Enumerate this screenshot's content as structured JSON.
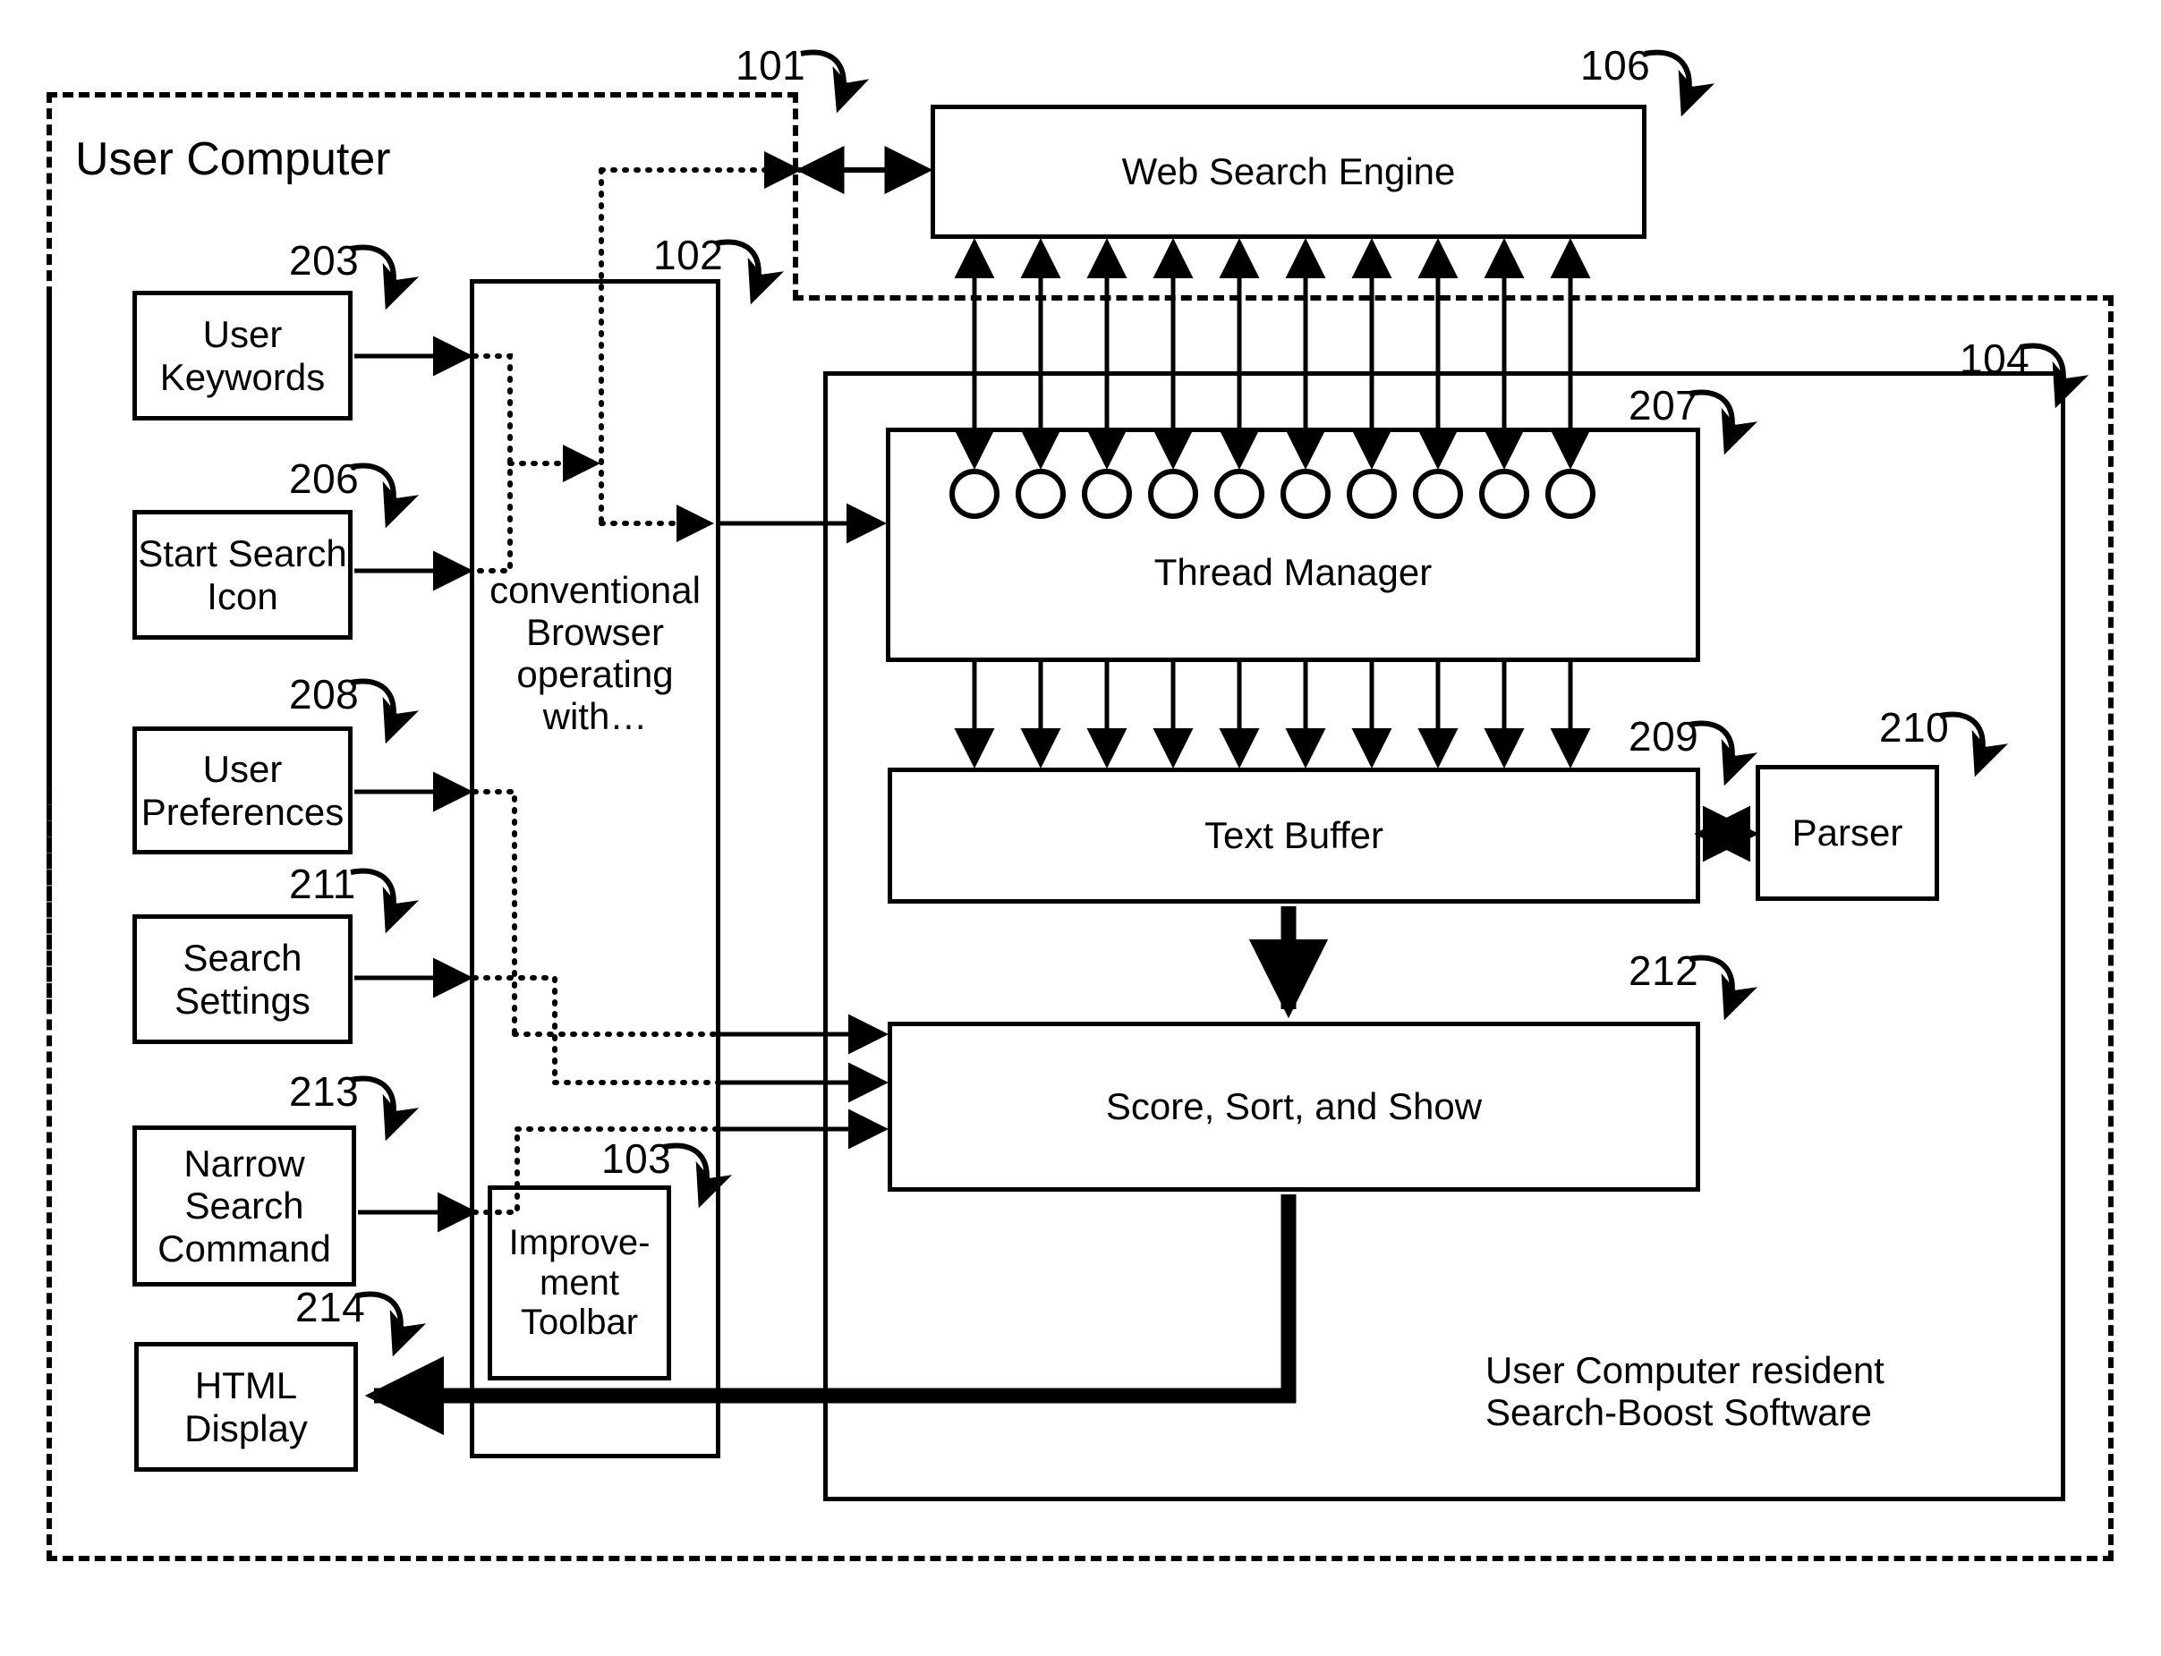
{
  "figure": {
    "outer_label": "User Computer",
    "inner_note_line1": "User Computer resident",
    "inner_note_line2": "Search-Boost Software"
  },
  "reference_numerals": {
    "user_computer_boundary": "101",
    "browser": "102",
    "improvement_toolbar": "103",
    "search_boost_software": "104",
    "web_search_engine": "106",
    "user_keywords": "203",
    "start_search_icon": "206",
    "thread_manager": "207",
    "user_preferences": "208",
    "text_buffer": "209",
    "parser": "210",
    "search_settings": "211",
    "score_sort_show": "212",
    "narrow_search_command": "213",
    "html_display": "214"
  },
  "blocks": {
    "web_search_engine": {
      "label": "Web Search Engine",
      "ref": "106"
    },
    "user_keywords": {
      "label": "User\nKeywords",
      "line1": "User",
      "line2": "Keywords",
      "ref": "203"
    },
    "start_search_icon": {
      "line1": "Start Search",
      "line2": "Icon",
      "ref": "206"
    },
    "user_preferences": {
      "line1": "User",
      "line2": "Preferences",
      "ref": "208"
    },
    "search_settings": {
      "line1": "Search",
      "line2": "Settings",
      "ref": "211"
    },
    "narrow_search_command": {
      "line1": "Narrow",
      "line2": "Search",
      "line3": "Command",
      "ref": "213"
    },
    "html_display": {
      "line1": "HTML",
      "line2": "Display",
      "ref": "214"
    },
    "browser": {
      "line1": "conventional",
      "line2": "Browser",
      "line3": "operating",
      "line4": "with…",
      "ref": "102"
    },
    "improvement_toolbar": {
      "line1": "Improve-",
      "line2": "ment",
      "line3": "Toolbar",
      "ref": "103"
    },
    "thread_manager": {
      "label": "Thread Manager",
      "ref": "207",
      "thread_count": 10
    },
    "text_buffer": {
      "label": "Text Buffer",
      "ref": "209"
    },
    "parser": {
      "label": "Parser",
      "ref": "210"
    },
    "score_sort_show": {
      "label": "Score, Sort, and Show",
      "ref": "212"
    }
  },
  "colors": {
    "ink": "#000000",
    "paper": "#ffffff"
  }
}
